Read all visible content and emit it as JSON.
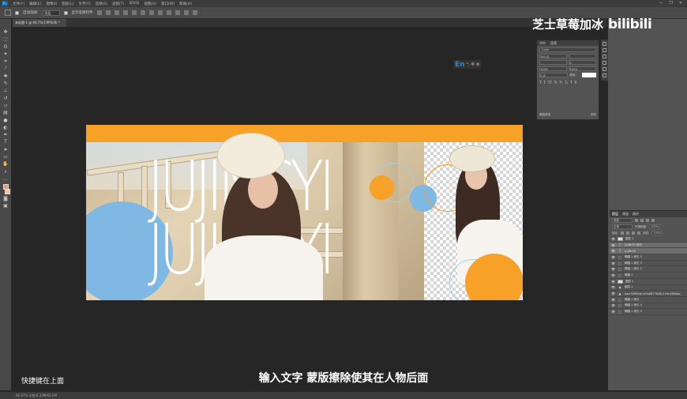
{
  "app": {
    "menu": [
      "文件(F)",
      "编辑(E)",
      "图像(I)",
      "图层(L)",
      "文字(Y)",
      "选择(S)",
      "滤镜(T)",
      "3D(D)",
      "视图(V)",
      "窗口(W)",
      "帮助(H)"
    ],
    "window_controls": [
      "—",
      "❐",
      "✕"
    ]
  },
  "options_bar": {
    "auto_select_label": "自动选择:",
    "auto_select_value": "图层",
    "show_transform_label": "显示变换控件"
  },
  "document_tab": {
    "title": "未标题-1 @ 66.7%(CMYK/8) *"
  },
  "design": {
    "big_text_line1": "JUJINGYI",
    "big_text_line2": "JUJINGYI",
    "colors": {
      "orange": "#f7a128",
      "blue": "#80b8e4",
      "white": "#ffffff"
    }
  },
  "ime_indicator": {
    "lang": "En",
    "symbols": "°, 半 ⚙"
  },
  "character_panel": {
    "tabs": [
      "字符",
      "段落"
    ],
    "font_name": "Carle",
    "font_size": "100 点",
    "tracking": "0",
    "scale_v": "100%",
    "scale_h": "100%",
    "baseline": "0 点",
    "color_label": "颜色:",
    "styles": [
      "T",
      "T",
      "TT",
      "Tr",
      "T¹",
      "T₁",
      "T",
      "T̶"
    ],
    "language": "美国英语",
    "aa": "锐利"
  },
  "layers_panel": {
    "tabs": [
      "图层",
      "通道",
      "路径"
    ],
    "kind_label": "类型",
    "blend_mode": "正常",
    "opacity_label": "不透明度:",
    "opacity_value": "100%",
    "lock_label": "锁定:",
    "fill_label": "填充:",
    "fill_value": "100%",
    "layers": [
      {
        "type": "box",
        "name": "图层 1",
        "selected": false
      },
      {
        "type": "T",
        "name": "JUJINGYI 拷贝",
        "selected": true
      },
      {
        "type": "T",
        "name": "JUJINGYI",
        "selected": true
      },
      {
        "type": "□",
        "name": "椭圆 1 拷贝 2",
        "selected": false
      },
      {
        "type": "□",
        "name": "椭圆 1 拷贝 3",
        "selected": false
      },
      {
        "type": "□",
        "name": "椭圆 1 拷贝 2",
        "selected": false
      },
      {
        "type": "□",
        "name": "椭圆 1",
        "selected": false
      },
      {
        "type": "box",
        "name": "图层 2",
        "selected": false
      },
      {
        "type": "♟",
        "name": "图层 1",
        "selected": false
      },
      {
        "type": "▲",
        "name": "dafc30f69de1e9a6877818c11fe1f69aba",
        "selected": false
      },
      {
        "type": "□",
        "name": "椭圆 1 拷贝",
        "selected": false
      },
      {
        "type": "□",
        "name": "椭圆 1 拷贝 4",
        "selected": false
      },
      {
        "type": "□",
        "name": "椭圆 1 拷贝 4",
        "selected": false
      }
    ]
  },
  "status_bar": {
    "text": "66.67%    文档:6.33M/62.5M"
  },
  "subtitle": {
    "main": "输入文字 蒙版擦除使其在人物后面",
    "left": "快捷键在上面"
  },
  "watermark": {
    "channel": "芝士草莓加冰",
    "logo": "bilibili"
  }
}
